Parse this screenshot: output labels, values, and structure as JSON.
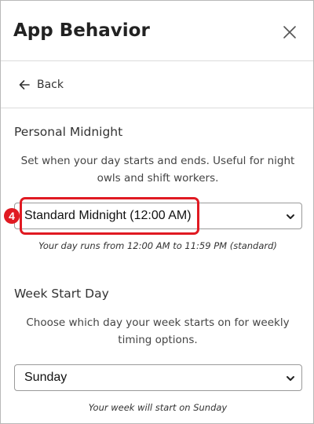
{
  "header": {
    "title": "App Behavior",
    "close_icon": "close-icon"
  },
  "nav": {
    "back_label": "Back",
    "back_icon": "arrow-left-icon"
  },
  "personal_midnight": {
    "title": "Personal Midnight",
    "description": "Set when your day starts and ends. Useful for night owls and shift workers.",
    "selected_value": "Standard Midnight (12:00 AM)",
    "hint": "Your day runs from 12:00 AM to 11:59 PM (standard)"
  },
  "week_start": {
    "title": "Week Start Day",
    "description": "Choose which day your week starts on for weekly timing options.",
    "selected_value": "Sunday",
    "hint": "Your week will start on Sunday"
  },
  "annotation": {
    "step_number": "4",
    "highlight_color": "#e01a22"
  }
}
